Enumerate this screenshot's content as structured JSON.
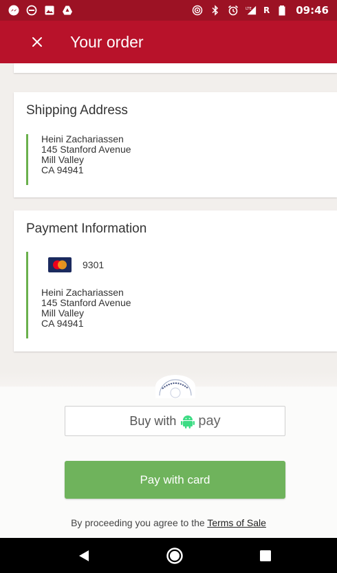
{
  "status_bar": {
    "time": "09:46",
    "network_badge": "R",
    "icons_left": [
      "messenger-icon",
      "do-not-disturb-icon",
      "image-icon",
      "drive-icon"
    ],
    "icons_right": [
      "hotspot-icon",
      "bluetooth-icon",
      "alarm-icon",
      "lte-signal-icon",
      "battery-icon"
    ]
  },
  "app_bar": {
    "title": "Your order",
    "close_icon": "close-icon",
    "color": "#b8122a"
  },
  "shipping": {
    "heading": "Shipping Address",
    "lines": [
      "Heini Zachariassen",
      "145 Stanford Avenue",
      "Mill Valley",
      "CA 94941"
    ]
  },
  "payment": {
    "heading": "Payment Information",
    "card_brand_icon": "mastercard-icon",
    "last4": "9301",
    "lines": [
      "Heini Zachariassen",
      "145 Stanford Avenue",
      "Mill Valley",
      "CA 94941"
    ]
  },
  "sheet": {
    "gpay_prefix": "Buy with",
    "gpay_suffix": "pay",
    "card_button": "Pay with card",
    "terms_prefix": "By proceeding you agree to the ",
    "terms_link": "Terms of Sale",
    "accent_green": "#6fb35c"
  },
  "nav": {
    "icons": [
      "back-icon",
      "home-icon",
      "recents-icon"
    ]
  }
}
